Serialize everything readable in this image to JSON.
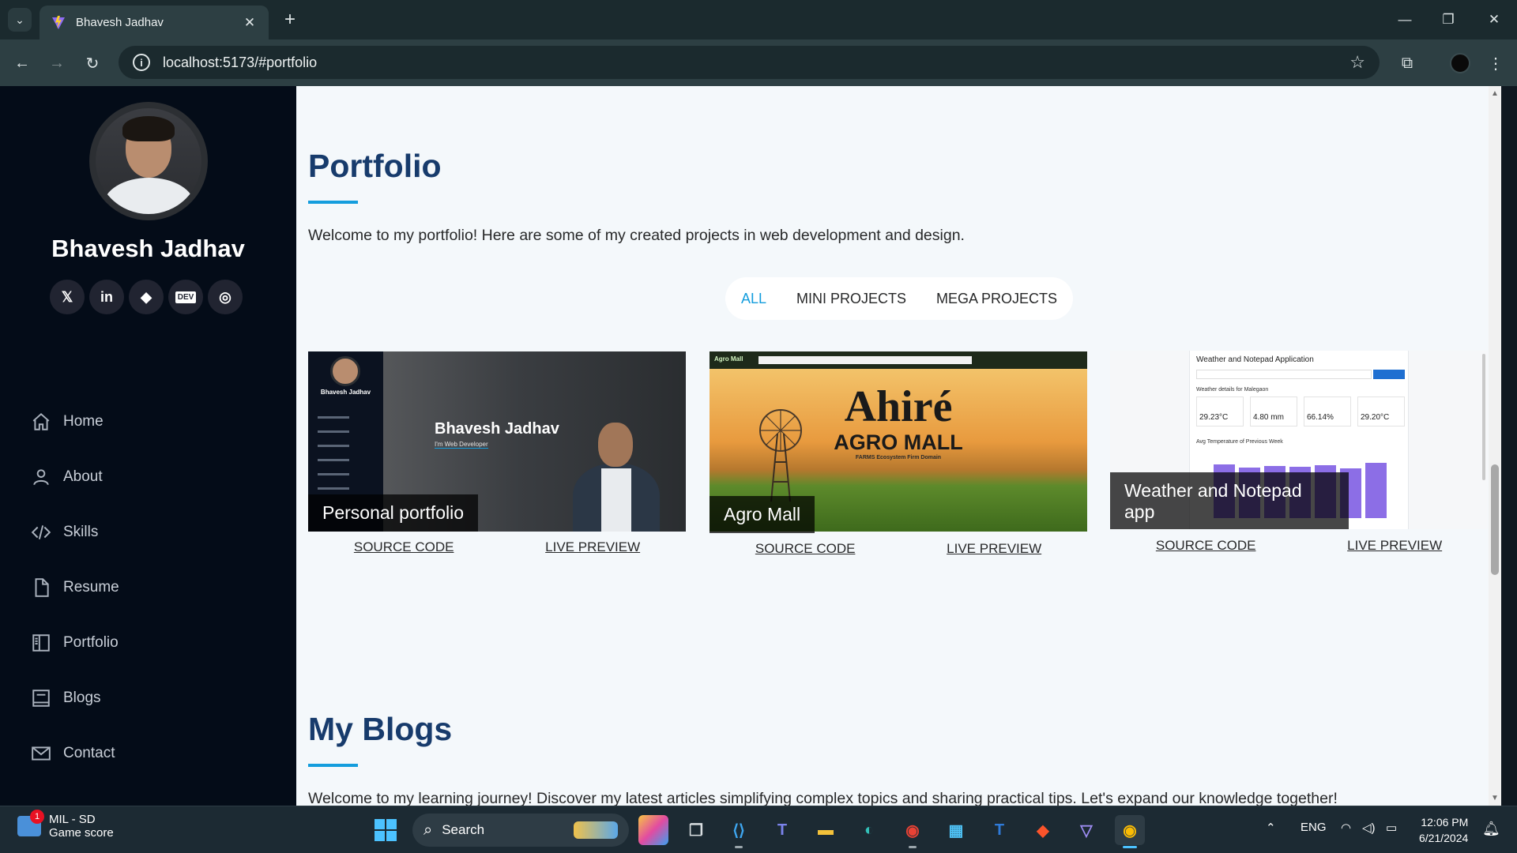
{
  "browser": {
    "tab_title": "Bhavesh Jadhav",
    "url": "localhost:5173/#portfolio"
  },
  "sidebar": {
    "name": "Bhavesh Jadhav",
    "socials": [
      {
        "icon": "x-twitter-icon",
        "glyph": "𝕏"
      },
      {
        "icon": "linkedin-icon",
        "glyph": "in"
      },
      {
        "icon": "hashnode-icon",
        "glyph": "◆"
      },
      {
        "icon": "dev-to-icon",
        "glyph": "DEV"
      },
      {
        "icon": "instagram-icon",
        "glyph": "◎"
      }
    ],
    "nav": [
      {
        "label": "Home",
        "icon": "home-icon"
      },
      {
        "label": "About",
        "icon": "person-icon"
      },
      {
        "label": "Skills",
        "icon": "code-icon"
      },
      {
        "label": "Resume",
        "icon": "file-icon"
      },
      {
        "label": "Portfolio",
        "icon": "book-icon"
      },
      {
        "label": "Blogs",
        "icon": "journal-icon"
      },
      {
        "label": "Contact",
        "icon": "envelope-icon"
      }
    ]
  },
  "portfolio": {
    "title": "Portfolio",
    "description": "Welcome to my portfolio! Here are some of my created projects in web development and design.",
    "filters": [
      "ALL",
      "MINI PROJECTS",
      "MEGA PROJECTS"
    ],
    "active_filter": "ALL",
    "projects": [
      {
        "label": "Personal portfolio",
        "source_label": "SOURCE CODE",
        "preview_label": "LIVE PREVIEW",
        "thumb": {
          "name": "Bhavesh Jadhav",
          "sub": "I'm Web Developer",
          "mini_name": "Bhavesh Jadhav"
        }
      },
      {
        "label": "Agro Mall",
        "source_label": "SOURCE CODE",
        "preview_label": "LIVE PREVIEW",
        "thumb": {
          "brand": "Agro Mall",
          "headline": "Ahiré",
          "subhead": "AGRO MALL",
          "tag": "FARMS Ecosystem Firm Domain"
        }
      },
      {
        "label": "Weather and Notepad app",
        "source_label": "SOURCE CODE",
        "preview_label": "LIVE PREVIEW",
        "thumb": {
          "heading": "Weather and Notepad Application",
          "sub": "Weather details for Malegaon",
          "stats": [
            "29.23°C",
            "4.80 mm",
            "66.14%",
            "29.20°C"
          ],
          "chart_title": "Avg Temperature of Previous Week"
        }
      }
    ]
  },
  "blogs": {
    "title": "My Blogs",
    "description": "Welcome to my learning journey! Discover my latest articles simplifying complex topics and sharing practical tips. Let's expand our knowledge together!"
  },
  "taskbar": {
    "widget_title": "MIL - SD",
    "widget_sub": "Game score",
    "widget_badge": "1",
    "search_placeholder": "Search",
    "lang": "ENG",
    "time": "12:06 PM",
    "date": "6/21/2024"
  },
  "colors": {
    "accent": "#149ddd",
    "heading": "#173b6c",
    "sidebar_bg": "#040c18"
  }
}
